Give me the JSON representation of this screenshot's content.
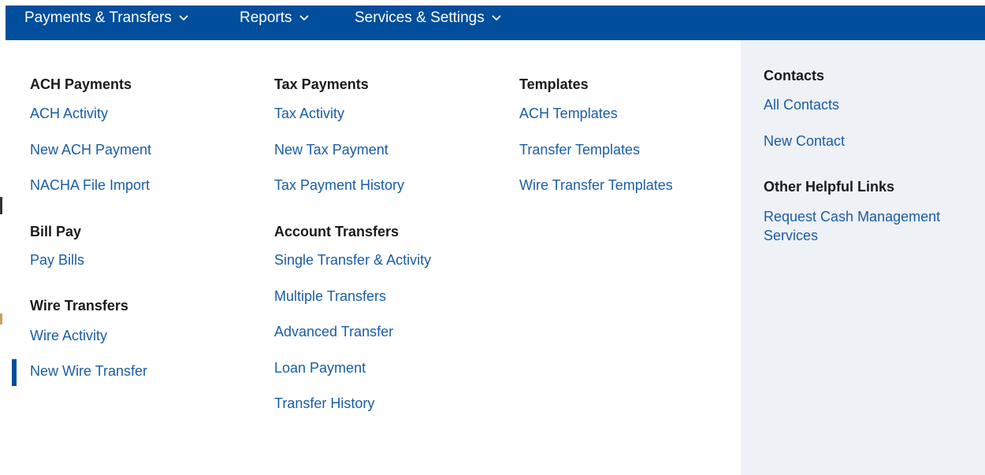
{
  "nav": {
    "items": [
      {
        "label": "Payments & Transfers"
      },
      {
        "label": "Reports"
      },
      {
        "label": "Services & Settings"
      }
    ]
  },
  "menu": {
    "col1": {
      "ach_heading": "ACH Payments",
      "ach_links": [
        "ACH Activity",
        "New ACH Payment",
        "NACHA File Import"
      ],
      "billpay_heading": "Bill Pay",
      "billpay_links": [
        "Pay Bills"
      ],
      "wire_heading": "Wire Transfers",
      "wire_links": [
        "Wire Activity",
        "New Wire Transfer"
      ]
    },
    "col2": {
      "tax_heading": "Tax Payments",
      "tax_links": [
        "Tax Activity",
        "New Tax Payment",
        "Tax Payment History"
      ],
      "account_heading": "Account Transfers",
      "account_links": [
        "Single Transfer & Activity",
        "Multiple Transfers",
        "Advanced Transfer",
        "Loan Payment",
        "Transfer History"
      ]
    },
    "col3": {
      "templates_heading": "Templates",
      "templates_links": [
        "ACH Templates",
        "Transfer Templates",
        "Wire Transfer Templates"
      ]
    },
    "right": {
      "contacts_heading": "Contacts",
      "contacts_links": [
        "All Contacts",
        "New Contact"
      ],
      "helpful_heading": "Other Helpful Links",
      "helpful_links": [
        "Request Cash Management Services"
      ]
    }
  },
  "colors": {
    "nav_bg": "#014e9c",
    "link": "#1a5da6",
    "heading": "#1b1b1b",
    "panel_bg": "#eef1f6"
  }
}
